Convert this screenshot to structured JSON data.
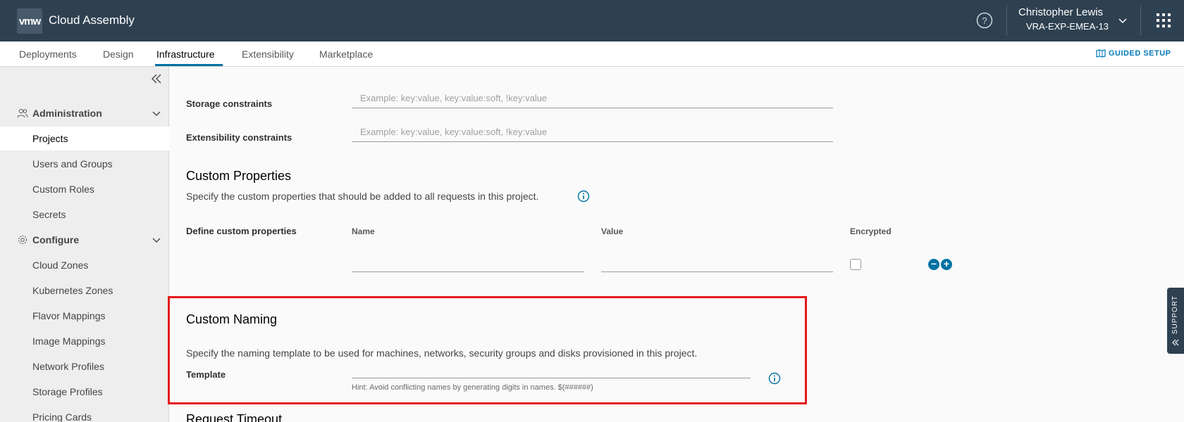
{
  "header": {
    "logo": "vmw",
    "app_title": "Cloud Assembly",
    "user_name": "Christopher Lewis",
    "user_org": "VRA-EXP-EMEA-13"
  },
  "tabs": [
    {
      "label": "Deployments"
    },
    {
      "label": "Design"
    },
    {
      "label": "Infrastructure",
      "active": true
    },
    {
      "label": "Extensibility"
    },
    {
      "label": "Marketplace"
    }
  ],
  "guided_setup": "GUIDED SETUP",
  "sidebar": {
    "groups": [
      {
        "label": "Administration",
        "icon": "users-icon"
      },
      {
        "label": "Configure",
        "icon": "gear-icon"
      }
    ],
    "admin_items": [
      "Projects",
      "Users and Groups",
      "Custom Roles",
      "Secrets"
    ],
    "config_items": [
      "Cloud Zones",
      "Kubernetes Zones",
      "Flavor Mappings",
      "Image Mappings",
      "Network Profiles",
      "Storage Profiles",
      "Pricing Cards"
    ]
  },
  "constraints": {
    "storage_label": "Storage constraints",
    "storage_placeholder": "Example: key:value, key:value:soft, !key:value",
    "extensibility_label": "Extensibility constraints",
    "extensibility_placeholder": "Example: key:value, key:value:soft, !key:value"
  },
  "custom_properties": {
    "title": "Custom Properties",
    "description": "Specify the custom properties that should be added to all requests in this project.",
    "define_label": "Define custom properties",
    "col_name": "Name",
    "col_value": "Value",
    "col_encrypted": "Encrypted"
  },
  "custom_naming": {
    "title": "Custom Naming",
    "description": "Specify the naming template to be used for machines, networks, security groups and disks provisioned in this project.",
    "template_label": "Template",
    "hint": "Hint: Avoid conflicting names by generating digits in names. $(######)"
  },
  "request_timeout_title": "Request Timeout",
  "support_label": "SUPPORT",
  "colors": {
    "header_bg": "#2e4151",
    "accent": "#0072a3",
    "highlight": "#e51a1a"
  }
}
